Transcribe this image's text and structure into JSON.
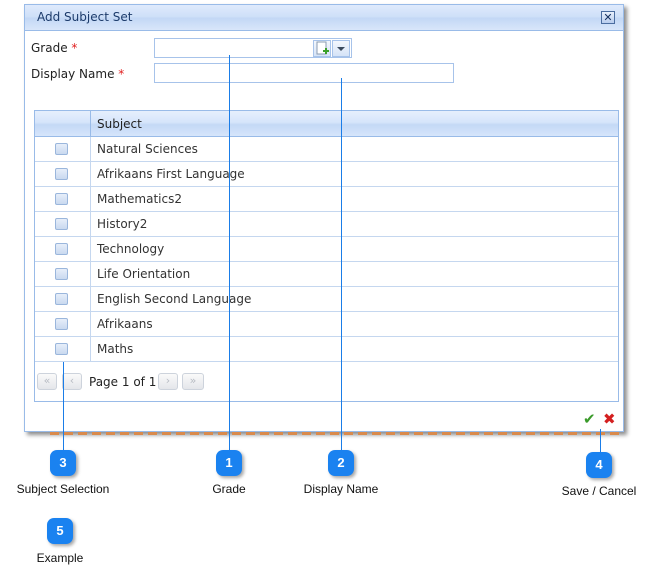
{
  "dialog": {
    "title": "Add Subject Set",
    "close_icon": "close-icon",
    "form": {
      "grade_label": "Grade",
      "display_name_label": "Display Name",
      "required_marker": "*",
      "grade_value": "",
      "display_name_value": "",
      "grade_add_icon": "add-document-icon",
      "grade_dropdown_icon": "chevron-down-icon"
    },
    "grid": {
      "columns": [
        "",
        "Subject"
      ],
      "rows": [
        {
          "subject": "Natural Sciences",
          "checked": false
        },
        {
          "subject": "Afrikaans First Language",
          "checked": false
        },
        {
          "subject": "Mathematics2",
          "checked": false
        },
        {
          "subject": "History2",
          "checked": false
        },
        {
          "subject": "Technology",
          "checked": false
        },
        {
          "subject": "Life Orientation",
          "checked": false
        },
        {
          "subject": "English Second Language",
          "checked": false
        },
        {
          "subject": "Afrikaans",
          "checked": false
        },
        {
          "subject": "Maths",
          "checked": false
        }
      ],
      "pager": {
        "first": "«",
        "prev": "‹",
        "text": "Page 1 of 1",
        "next": "›",
        "last": "»"
      }
    },
    "actions": {
      "save_icon": "✔",
      "cancel_icon": "✖"
    }
  },
  "callouts": [
    {
      "number": "1",
      "label": "Grade"
    },
    {
      "number": "2",
      "label": "Display Name"
    },
    {
      "number": "3",
      "label": "Subject Selection"
    },
    {
      "number": "4",
      "label": "Save / Cancel"
    },
    {
      "number": "5",
      "label": "Example"
    }
  ],
  "colors": {
    "callout": "#1a82f0",
    "required": "#e02020",
    "save": "#3a9a2a",
    "cancel": "#d42020"
  }
}
